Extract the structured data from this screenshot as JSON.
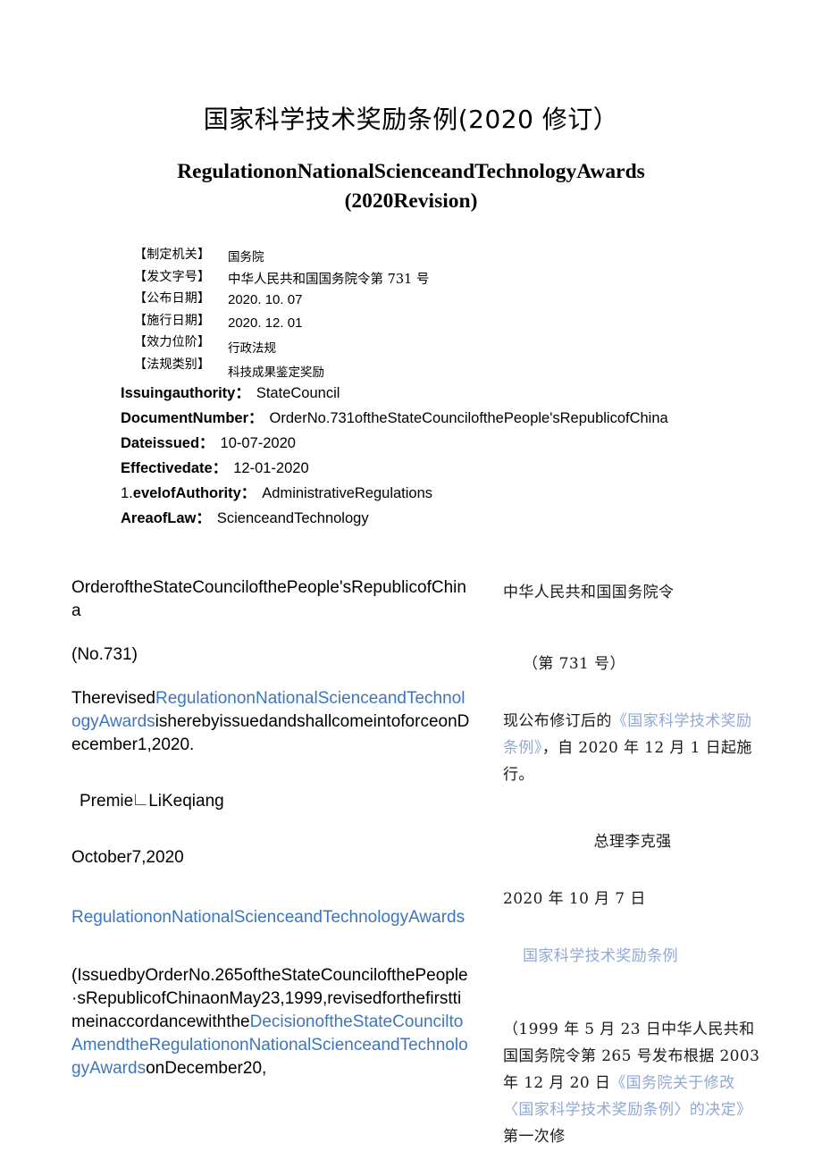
{
  "document": {
    "title_cn": "国家科学技术奖励条例(2020 修订）",
    "title_en_line1": "RegulationonNationalScienceandTechnologyAwards",
    "title_en_line2": "(2020Revision)"
  },
  "metadata_cn": {
    "rows": [
      {
        "label": "【制定机关】",
        "value": "国务院"
      },
      {
        "label": "【发文字号】",
        "value": "中华人民共和国国务院令第 731 号"
      },
      {
        "label": "【公布日期】",
        "value": "2020. 10. 07"
      },
      {
        "label": "【施行日期】",
        "value": "2020. 12. 01"
      },
      {
        "label": "【效力位阶】",
        "value": "行政法规"
      },
      {
        "label": "【法规类别】",
        "value": "科技成果鉴定奖励"
      }
    ]
  },
  "metadata_en": {
    "issuing_authority_label": "Issuingauthority：",
    "issuing_authority_value": "StateCouncil",
    "document_number_label": "DocumentNumber：",
    "document_number_value": "OrderNo.731oftheStateCouncilofthePeople'sRepublicofChina",
    "date_issued_label": "Dateissued：",
    "date_issued_value": "10-07-2020",
    "effective_date_label": "Effectivedate：",
    "effective_date_value": "12-01-2020",
    "level_of_authority_lead": "1.",
    "level_of_authority_label": "evelofAuthority：",
    "level_of_authority_value": "AdministrativeRegulations",
    "area_of_law_label": "AreaofLaw：",
    "area_of_law_value": "ScienceandTechnology"
  },
  "body_en": {
    "order_heading": "OrderoftheStateCouncilofthePeople'sRepublicofChina",
    "order_number": "(No.731)",
    "revised_p1": "Therevised",
    "revised_link": "RegulationonNationalScienceandTechnologyAwards",
    "revised_p2": "isherebyissuedandshallcomeintoforceonDecember1,2020.",
    "premier_pre": "Premie",
    "premier_post": "LiKeqiang",
    "date_line": "October7,2020",
    "regulation_heading_link": "RegulationonNationalScienceandTechnologyAwards",
    "issued_p1": "(IssuedbyOrderNo.265oftheStateCouncilofthePeople·sRepublicofChinaonMay23,1999,revisedforthefirsttimeinaccordancewiththe",
    "issued_link": "DecisionoftheStateCounciltoAmendtheRegulationonNationalScienceandTechnologyAwards",
    "issued_p2": "onDecember20,"
  },
  "body_cn": {
    "order_heading": "中华人民共和国国务院令",
    "order_number": "（第 731 号）",
    "revised_p1": "现公布修订后的",
    "revised_link": "《国家科学技术奖励条例》",
    "revised_p2": "，自 2020 年 12 月 1 日起施行。",
    "premier_line": "总理李克强",
    "date_line": "2020 年 10 月 7 日",
    "regulation_heading_link": "国家科学技术奖励条例",
    "issued_p1": "（1999 年 5 月 23 日中华人民共和国国务院令第 265 号发布根据 2003 年 12 月 20 日",
    "issued_link": "《国务院关于修改〈国家科学技术奖励条例〉的决定》",
    "issued_p2": "第一次修"
  },
  "colors": {
    "link_en": "#3d76bd",
    "link_cn": "#8fa9d4",
    "text": "#000000",
    "background": "#ffffff"
  }
}
